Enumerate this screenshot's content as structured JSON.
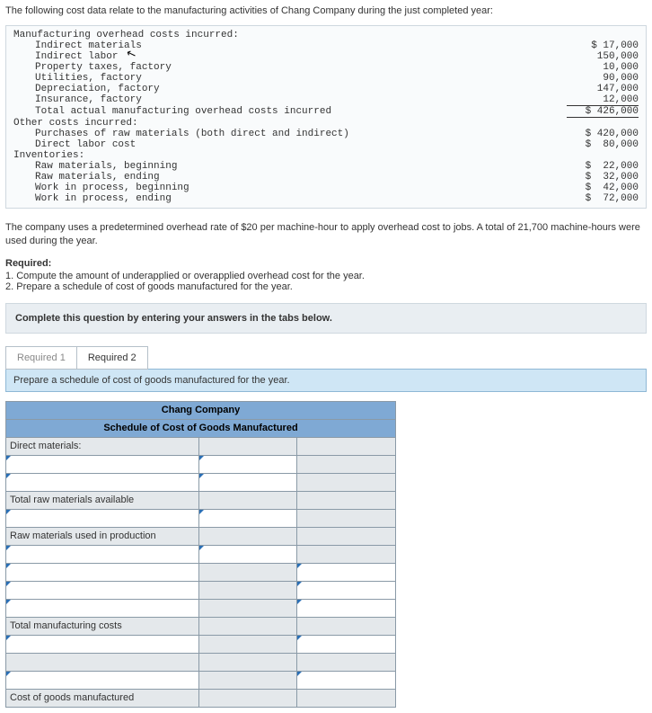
{
  "intro": "The following cost data relate to the manufacturing activities of Chang Company during the just completed year:",
  "overhead_header": "Manufacturing overhead costs incurred:",
  "overhead_items": [
    {
      "label": "Indirect materials",
      "amount": "$ 17,000"
    },
    {
      "label": "Indirect labor",
      "amount": "150,000"
    },
    {
      "label": "Property taxes, factory",
      "amount": "10,000"
    },
    {
      "label": "Utilities, factory",
      "amount": "90,000"
    },
    {
      "label": "Depreciation, factory",
      "amount": "147,000"
    },
    {
      "label": "Insurance, factory",
      "amount": "12,000"
    }
  ],
  "overhead_total": {
    "label": "Total actual manufacturing overhead costs incurred",
    "amount": "$ 426,000"
  },
  "other_header": "Other costs incurred:",
  "other_items": [
    {
      "label": "Purchases of raw materials (both direct and indirect)",
      "amount": "$ 420,000"
    },
    {
      "label": "Direct labor cost",
      "amount": "$  80,000"
    }
  ],
  "inv_header": "Inventories:",
  "inv_items": [
    {
      "label": "Raw materials, beginning",
      "amount": "$  22,000"
    },
    {
      "label": "Raw materials, ending",
      "amount": "$  32,000"
    },
    {
      "label": "Work in process, beginning",
      "amount": "$  42,000"
    },
    {
      "label": "Work in process, ending",
      "amount": "$  72,000"
    }
  ],
  "mid_para": "The company uses a predetermined overhead rate of $20 per machine-hour to apply overhead cost to jobs. A total of 21,700 machine-hours were used during the year.",
  "required_head": "Required:",
  "required_1": "1. Compute the amount of underapplied or overapplied overhead cost for the year.",
  "required_2": "2. Prepare a schedule of cost of goods manufactured for the year.",
  "instruct": "Complete this question by entering your answers in the tabs below.",
  "tabs": {
    "r1": "Required 1",
    "r2": "Required 2"
  },
  "prompt": "Prepare a schedule of cost of goods manufactured for the year.",
  "sched": {
    "company": "Chang Company",
    "title": "Schedule of Cost of Goods Manufactured",
    "rows": {
      "direct_materials": "Direct materials:",
      "total_raw": "Total raw materials available",
      "raw_used": "Raw materials used in production",
      "total_mfg": "Total manufacturing costs",
      "cogm": "Cost of goods manufactured"
    }
  }
}
